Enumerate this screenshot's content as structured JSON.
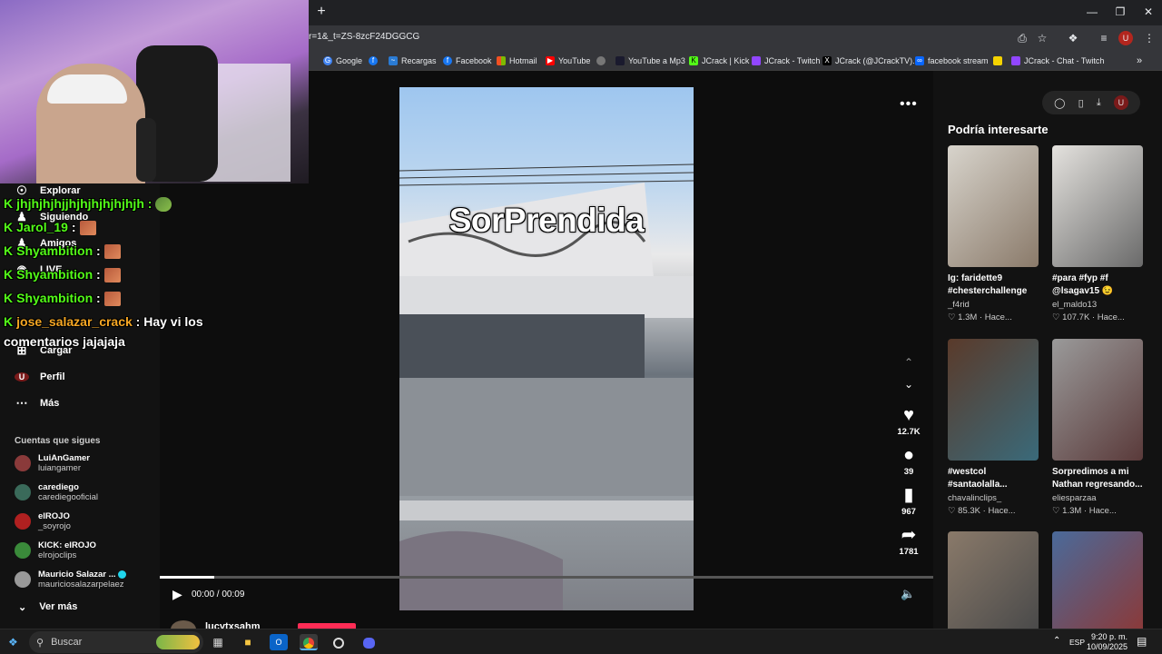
{
  "browser": {
    "url": "r=1&_t=ZS-8zcF24DGGCG",
    "bookmarks": [
      {
        "label": "Google",
        "color": "#4285f4"
      },
      {
        "label": "",
        "color": "#1877f2"
      },
      {
        "label": "Recargas",
        "color": "#2a7bd4"
      },
      {
        "label": "Facebook",
        "color": "#1877f2"
      },
      {
        "label": "Hotmail",
        "color": "#f25022"
      },
      {
        "label": "YouTube",
        "color": "#ff0000"
      },
      {
        "label": "",
        "color": "#777777"
      },
      {
        "label": "YouTube a Mp3",
        "color": "#1a1a2e"
      },
      {
        "label": "JCrack | Kick",
        "color": "#53fc18"
      },
      {
        "label": "JCrack - Twitch",
        "color": "#9146ff"
      },
      {
        "label": "JCrack (@JCrackTV)...",
        "color": "#000000"
      },
      {
        "label": "facebook stream",
        "color": "#0866ff"
      },
      {
        "label": "",
        "color": "#f5d300"
      },
      {
        "label": "JCrack - Chat - Twitch",
        "color": "#9146ff"
      }
    ]
  },
  "sidenav": {
    "items": [
      {
        "label": "Explorar",
        "icon": "compass-icon"
      },
      {
        "label": "Siguiendo",
        "icon": "person-icon"
      },
      {
        "label": "Amigos",
        "icon": "friends-icon"
      },
      {
        "label": "LIVE",
        "icon": "live-icon"
      },
      {
        "label": "Cargar",
        "icon": "plus-square-icon"
      },
      {
        "label": "Perfil",
        "icon": "profile-icon"
      },
      {
        "label": "Más",
        "icon": "ellipsis-icon"
      }
    ],
    "following_title": "Cuentas que sigues",
    "accounts": [
      {
        "name": "LuiAnGamer",
        "handle": "luiangamer",
        "color": "#8a3a3a"
      },
      {
        "name": "carediego",
        "handle": "carediegooficial",
        "color": "#3a6a5a"
      },
      {
        "name": "elROJO",
        "handle": "_soyrojo",
        "color": "#b02020"
      },
      {
        "name": "KICK: elROJO",
        "handle": "elrojoclips",
        "color": "#3a8a3a"
      },
      {
        "name": "Mauricio Salazar ...",
        "handle": "mauriciosalazarpelaez",
        "color": "#999999"
      }
    ],
    "see_more": "Ver más"
  },
  "player": {
    "caption": "SorPrendida",
    "likes": "12.7K",
    "comments": "39",
    "saves": "967",
    "shares": "1781",
    "time": "00:00 / 00:09",
    "progress": 0.07,
    "author": "lucytxsahm"
  },
  "recommendations": {
    "title": "Podría interesarte",
    "cards": [
      {
        "title": "Ig: faridette9 #chesterchallenge",
        "user": "_f4rid",
        "stats": "1.3M · Hace...",
        "colors": [
          "#d8d4cc",
          "#8a7a6a"
        ]
      },
      {
        "title": "#para #fyp #f @lsagav15 😉",
        "user": "el_maldo13",
        "stats": "107.7K · Hace...",
        "colors": [
          "#e4e2de",
          "#6a6a6a"
        ]
      },
      {
        "title": "#westcol #santaolalla...",
        "user": "chavalinclips_",
        "stats": "85.3K · Hace...",
        "colors": [
          "#5a3a2a",
          "#3a6a7a"
        ]
      },
      {
        "title": "Sorpredimos a mi Nathan regresando...",
        "user": "eliesparzaa",
        "stats": "1.3M · Hace...",
        "colors": [
          "#9a9a9a",
          "#5a3a3a"
        ]
      },
      {
        "title": "",
        "user": "",
        "stats": "",
        "colors": [
          "#8a7a6a",
          "#4a4a4a"
        ]
      },
      {
        "title": "",
        "user": "",
        "stats": "",
        "colors": [
          "#4a6a9a",
          "#8a3a3a"
        ]
      }
    ]
  },
  "chat": {
    "lines": [
      {
        "user": "",
        "message": "jhjhjhjhjjhjhjhjhjhjhjh :",
        "emote": "frog"
      },
      {
        "user": "Jarol_19",
        "message": " :",
        "emote": "face"
      },
      {
        "user": "Shyambition",
        "message": " :",
        "emote": "face"
      },
      {
        "user": "Shyambition",
        "message": " :",
        "emote": "face"
      },
      {
        "user": "Shyambition",
        "message": " :",
        "emote": "face"
      },
      {
        "user": "jose_salazar_crack",
        "message": " : Hay vi los",
        "emote": ""
      },
      {
        "user": "",
        "message": "comentarios jajajaja",
        "emote": ""
      }
    ]
  },
  "taskbar": {
    "search_placeholder": "Buscar",
    "lang": "ESP",
    "time": "9:20 p. m.",
    "date": "10/09/2025"
  }
}
